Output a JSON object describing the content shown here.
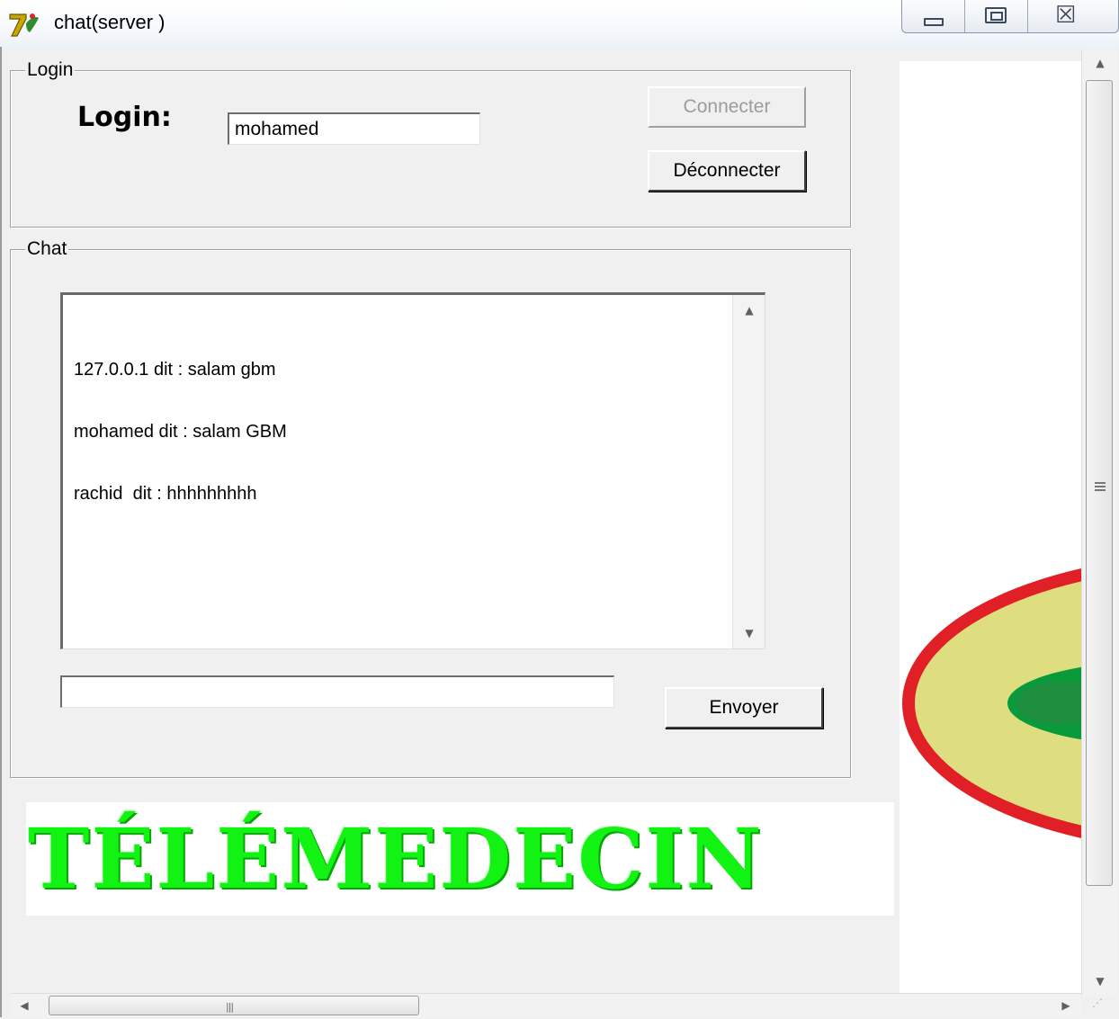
{
  "window": {
    "title": "chat(server )",
    "icon": "delphi-app-icon",
    "controls": [
      "minimize-icon",
      "maximize-icon",
      "close-icon"
    ],
    "close_glyph": "☒"
  },
  "login_group": {
    "legend": "Login",
    "label": "Login:",
    "username_value": "mohamed",
    "connect_label": "Connecter",
    "connect_enabled": false,
    "disconnect_label": "Déconnecter"
  },
  "chat_group": {
    "legend": "Chat",
    "messages": [
      "127.0.0.1 dit : salam gbm",
      "mohamed dit : salam GBM",
      "rachid  dit : hhhhhhhhh"
    ],
    "message_input_value": "",
    "send_label": "Envoyer"
  },
  "banner": {
    "text": "TÉLÉMEDECIN"
  },
  "colors": {
    "banner_green": "#13f313",
    "logo_red": "#e01f26",
    "logo_yellow": "#dede80",
    "logo_green": "#0a9a3b"
  }
}
